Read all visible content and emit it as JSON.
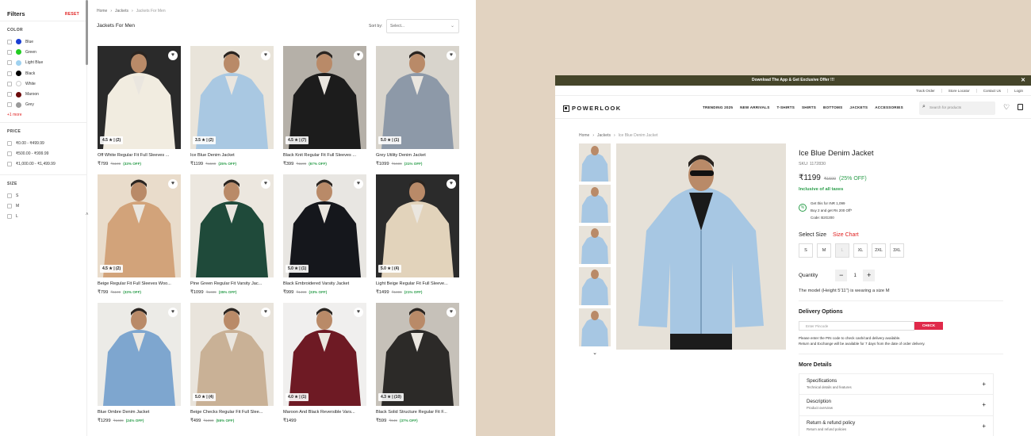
{
  "filters": {
    "title": "Filters",
    "reset": "RESET",
    "color_title": "COLOR",
    "colors": [
      {
        "label": "Blue",
        "swatch": "#1a3fd4"
      },
      {
        "label": "Green",
        "swatch": "#22cc22"
      },
      {
        "label": "Light Blue",
        "swatch": "#9fd1ef"
      },
      {
        "label": "Black",
        "swatch": "#000000"
      },
      {
        "label": "White",
        "swatch": "#ffffff"
      },
      {
        "label": "Maroon",
        "swatch": "#6b0a0a"
      },
      {
        "label": "Grey",
        "swatch": "#9a9a9a"
      }
    ],
    "more": "+1 more",
    "price_title": "PRICE",
    "prices": [
      "₹0.00 - ₹499.99",
      "₹500.00 - ₹999.99",
      "₹1,000.00 - ₹1,499.99"
    ],
    "size_title": "SIZE",
    "sizes": [
      "S",
      "M",
      "L"
    ],
    "scroll_indicator": "˄"
  },
  "listing": {
    "breadcrumb": [
      "Home",
      "Jackets",
      "Jackets For Men"
    ],
    "title": "Jackets For Men",
    "sort_label": "Sort by:",
    "sort_placeholder": "Select...",
    "products": [
      {
        "name": "Off White Regular Fit Full Sleeves ...",
        "price": "₹799",
        "mrp": "₹1199",
        "off": "(33% OFF)",
        "rating": "4.5 ★ | (2)",
        "bg": "#2a2a2a",
        "garment": "#f1ece0"
      },
      {
        "name": "Ice Blue Denim Jacket",
        "price": "₹1199",
        "mrp": "₹1599",
        "off": "(25% OFF)",
        "rating": "3.5 ★ | (2)",
        "bg": "#e9e4da",
        "garment": "#a9c8e2"
      },
      {
        "name": "Black Knit Regular Fit Full Sleeves ...",
        "price": "₹399",
        "mrp": "₹1199",
        "off": "(67% OFF)",
        "rating": "4.5 ★ | (7)",
        "bg": "#b5b0a8",
        "garment": "#1c1c1c"
      },
      {
        "name": "Grey Utility Denim Jacket",
        "price": "₹1099",
        "mrp": "₹1599",
        "off": "(31% OFF)",
        "rating": "5.0 ★ | (1)",
        "bg": "#d8d4cc",
        "garment": "#8d99a8"
      },
      {
        "name": "Beige Regular Fit Full Sleeves Woo...",
        "price": "₹799",
        "mrp": "₹1199",
        "off": "(33% OFF)",
        "rating": "4.5 ★ | (2)",
        "bg": "#e9dccb",
        "garment": "#d2a37a"
      },
      {
        "name": "Pine Green Regular Fit Varsity Jac...",
        "price": "₹1099",
        "mrp": "₹1699",
        "off": "(35% OFF)",
        "rating": "",
        "bg": "#ece7df",
        "garment": "#1f4a3a"
      },
      {
        "name": "Black Embroidered Varsity Jacket",
        "price": "₹999",
        "mrp": "₹1499",
        "off": "(33% OFF)",
        "rating": "5.0 ★ | (1)",
        "bg": "#e8e6e2",
        "garment": "#15171c"
      },
      {
        "name": "Light Beige Regular Fit Full Sleeve...",
        "price": "₹1499",
        "mrp": "₹1899",
        "off": "(21% OFF)",
        "rating": "5.0 ★ | (4)",
        "bg": "#2b2b2b",
        "garment": "#e2d3bb"
      },
      {
        "name": "Blue Ombre Denim Jacket",
        "price": "₹1299",
        "mrp": "₹1699",
        "off": "(24% OFF)",
        "rating": "",
        "bg": "#ecebe7",
        "garment": "#7ea6cf"
      },
      {
        "name": "Beige Checks Regular Fit Full Slee...",
        "price": "₹499",
        "mrp": "₹1099",
        "off": "(55% OFF)",
        "rating": "5.0 ★ | (4)",
        "bg": "#e9e4dc",
        "garment": "#c9b196"
      },
      {
        "name": "Maroon And Black Reversible Vars...",
        "price": "₹1499",
        "mrp": "",
        "off": "",
        "rating": "4.0 ★ | (1)",
        "bg": "#f0efee",
        "garment": "#6e1a24"
      },
      {
        "name": "Black Solid Structure Regular Fit F...",
        "price": "₹599",
        "mrp": "₹949",
        "off": "(37% OFF)",
        "rating": "4.3 ★ | (10)",
        "bg": "#c6c1b9",
        "garment": "#2c2a28"
      }
    ]
  },
  "pdp": {
    "promo": "Download The App & Get Exclusive Offer !!!",
    "utility": [
      "Track Order",
      "Store Locator",
      "Contact Us",
      "Login"
    ],
    "brand": "POWERLOOK",
    "menu": [
      "TRENDING 2025",
      "NEW ARRIVALS",
      "T-SHIRTS",
      "SHIRTS",
      "BOTTOMS",
      "JACKETS",
      "ACCESSORIES"
    ],
    "search_placeholder": "Search for products",
    "breadcrumb": [
      "Home",
      "Jackets",
      "Ice Blue Denim Jacket"
    ],
    "title": "Ice Blue Denim Jacket",
    "sku": "SKU: 1172830",
    "price": "₹1199",
    "mrp": "₹1599",
    "off": "(25% OFF)",
    "tax": "Inclusive of all taxes",
    "offer_lines": [
      "Get this for INR 1,099",
      "Buy 2 and get Rs 200 Off*",
      "Code: B2G200"
    ],
    "offer_icon": "%",
    "select_size": "Select Size",
    "size_chart": "Size Chart",
    "sizes": [
      "S",
      "M",
      "L",
      "XL",
      "2XL",
      "3XL"
    ],
    "unavailable_size": "L",
    "quantity_label": "Quantity",
    "quantity": "1",
    "model_note": "The model (Height 5'11\") is wearing a size M",
    "delivery_title": "Delivery Options",
    "pincode_placeholder": "Enter Pincode",
    "check": "CHECK",
    "delivery_note_1": "Please enter the PIN code to check cash/card delivery available.",
    "delivery_note_2": "Return and Exchange will be available for 7 days from the date of order delivery.",
    "more_details": "More Details",
    "accordions": [
      {
        "title": "Specifications",
        "sub": "Technical details and features"
      },
      {
        "title": "Description",
        "sub": "Product overview"
      },
      {
        "title": "Return & refund policy",
        "sub": "Return and refund policies"
      }
    ]
  }
}
